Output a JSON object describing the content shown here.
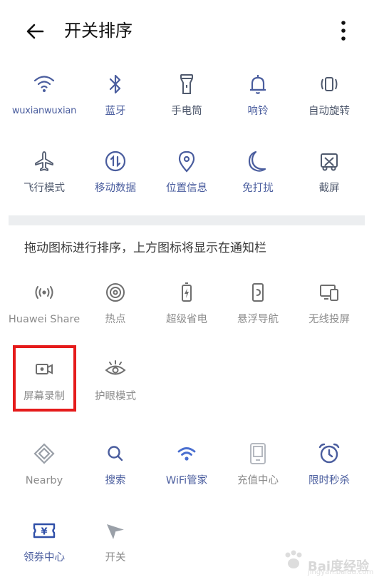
{
  "header": {
    "title": "开关排序"
  },
  "active_toggles": [
    {
      "label": "wuxianwuxian",
      "icon": "wifi-icon"
    },
    {
      "label": "蓝牙",
      "icon": "bluetooth-icon"
    },
    {
      "label": "手电筒",
      "icon": "flashlight-icon"
    },
    {
      "label": "响铃",
      "icon": "bell-icon"
    },
    {
      "label": "自动旋转",
      "icon": "auto-rotate-icon"
    },
    {
      "label": "飞行模式",
      "icon": "airplane-icon"
    },
    {
      "label": "移动数据",
      "icon": "mobile-data-icon"
    },
    {
      "label": "位置信息",
      "icon": "location-icon"
    },
    {
      "label": "免打扰",
      "icon": "moon-icon"
    },
    {
      "label": "截屏",
      "icon": "screenshot-icon"
    }
  ],
  "hint": "拖动图标进行排序，上方图标将显示在通知栏",
  "inactive_toggles": [
    {
      "label": "Huawei Share",
      "icon": "huawei-share-icon"
    },
    {
      "label": "热点",
      "icon": "hotspot-icon"
    },
    {
      "label": "超级省电",
      "icon": "battery-saver-icon"
    },
    {
      "label": "悬浮导航",
      "icon": "floating-nav-icon"
    },
    {
      "label": "无线投屏",
      "icon": "wireless-projection-icon"
    },
    {
      "label": "屏幕录制",
      "icon": "screen-record-icon"
    },
    {
      "label": "护眼模式",
      "icon": "eye-comfort-icon"
    }
  ],
  "app_toggles": [
    {
      "label": "Nearby",
      "icon": "nearby-icon"
    },
    {
      "label": "搜索",
      "icon": "search-icon"
    },
    {
      "label": "WiFi管家",
      "icon": "wifi-manager-icon"
    },
    {
      "label": "充值中心",
      "icon": "recharge-center-icon"
    },
    {
      "label": "限时秒杀",
      "icon": "alarm-clock-icon"
    },
    {
      "label": "领券中心",
      "icon": "coupon-icon"
    },
    {
      "label": "开关",
      "icon": "paper-plane-icon"
    }
  ],
  "watermark": {
    "text": "Bai度经验",
    "sub": "jingyan.baidu.com"
  },
  "colors": {
    "accent_blue": "#4a5d9e",
    "highlight_red": "#e51b1b",
    "muted_gray": "#8c8c8c"
  }
}
